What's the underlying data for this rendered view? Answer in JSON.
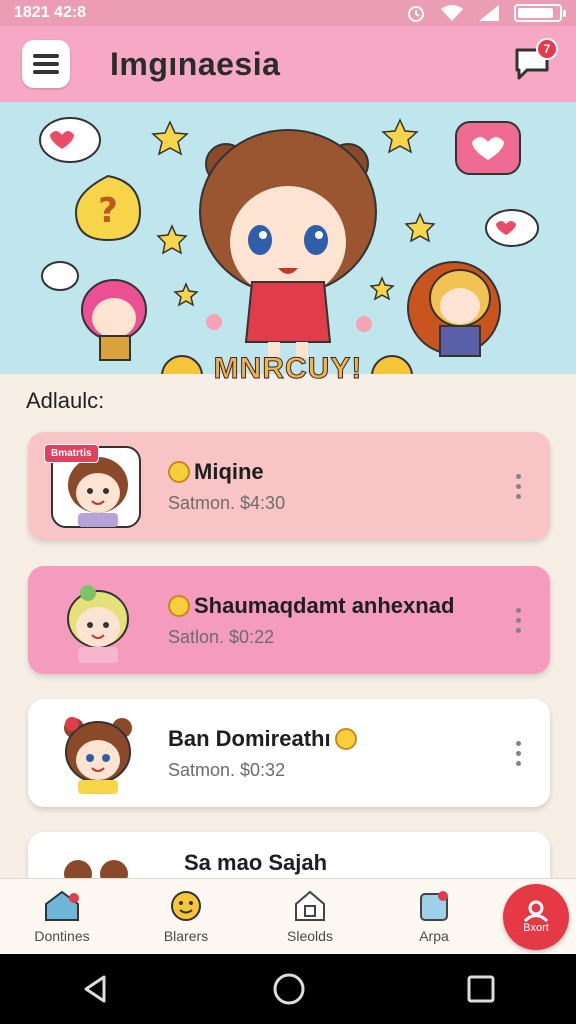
{
  "status_bar": {
    "time": "1821 42:8",
    "battery_level": 0.88
  },
  "app_bar": {
    "title": "Imgınaesia",
    "notification_count": "7"
  },
  "banner": {
    "title": "MNRCUY!"
  },
  "section": {
    "label": "Adlaulc:"
  },
  "cards": [
    {
      "title": "Miqine",
      "subtitle": "Satmon. $4:30",
      "tag": "Bmatrtis",
      "background": "#f9c4c6"
    },
    {
      "title": "Shaumaqdamt anhexnad",
      "subtitle": "Satlon. $0:22",
      "background": "#f59bbd"
    },
    {
      "title": "Ban Domireathı",
      "subtitle": "Satmon. $0:32",
      "background": "#ffffff"
    },
    {
      "title": "Sa mao Sajah",
      "background": "#ffffff"
    }
  ],
  "bottom_nav": {
    "items": [
      {
        "label": "Dontines",
        "icon": "home-icon"
      },
      {
        "label": "Blarers",
        "icon": "smiley-icon"
      },
      {
        "label": "Sleolds",
        "icon": "house-outline-icon"
      },
      {
        "label": "Arpa",
        "icon": "document-icon"
      }
    ],
    "fab_label": "Bxort"
  },
  "colors": {
    "accent": "#f7a8c4",
    "banner_bg": "#bfe6ec",
    "fab": "#e63946"
  }
}
